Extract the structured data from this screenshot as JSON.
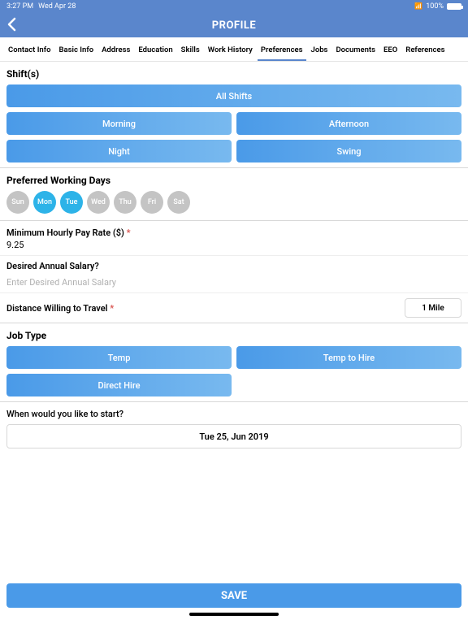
{
  "status": {
    "time": "3:27 PM",
    "date": "Wed Apr 28",
    "battery": "100%"
  },
  "header": {
    "title": "PROFILE"
  },
  "tabs": {
    "items": [
      "Contact Info",
      "Basic Info",
      "Address",
      "Education",
      "Skills",
      "Work History",
      "Preferences",
      "Jobs",
      "Documents",
      "EEO",
      "References"
    ],
    "active_index": 6
  },
  "shifts": {
    "label": "Shift(s)",
    "all": "All Shifts",
    "opts": [
      "Morning",
      "Afternoon",
      "Night",
      "Swing"
    ]
  },
  "days": {
    "label": "Preferred Working Days",
    "items": [
      {
        "abbr": "Sun",
        "on": false
      },
      {
        "abbr": "Mon",
        "on": true
      },
      {
        "abbr": "Tue",
        "on": true
      },
      {
        "abbr": "Wed",
        "on": false
      },
      {
        "abbr": "Thu",
        "on": false
      },
      {
        "abbr": "Fri",
        "on": false
      },
      {
        "abbr": "Sat",
        "on": false
      }
    ]
  },
  "pay": {
    "label": "Minimum Hourly Pay Rate ($) ",
    "req": "*",
    "value": "9.25"
  },
  "salary": {
    "label": "Desired Annual Salary?",
    "placeholder": "Enter Desired Annual Salary",
    "value": ""
  },
  "travel": {
    "label": "Distance Willing to Travel ",
    "req": "*",
    "value": "1 Mile"
  },
  "job_type": {
    "label": "Job Type",
    "opts": [
      "Temp",
      "Temp to Hire",
      "Direct Hire"
    ]
  },
  "start": {
    "label": "When would you like to start?",
    "value": "Tue 25, Jun 2019"
  },
  "save": {
    "label": "SAVE"
  }
}
